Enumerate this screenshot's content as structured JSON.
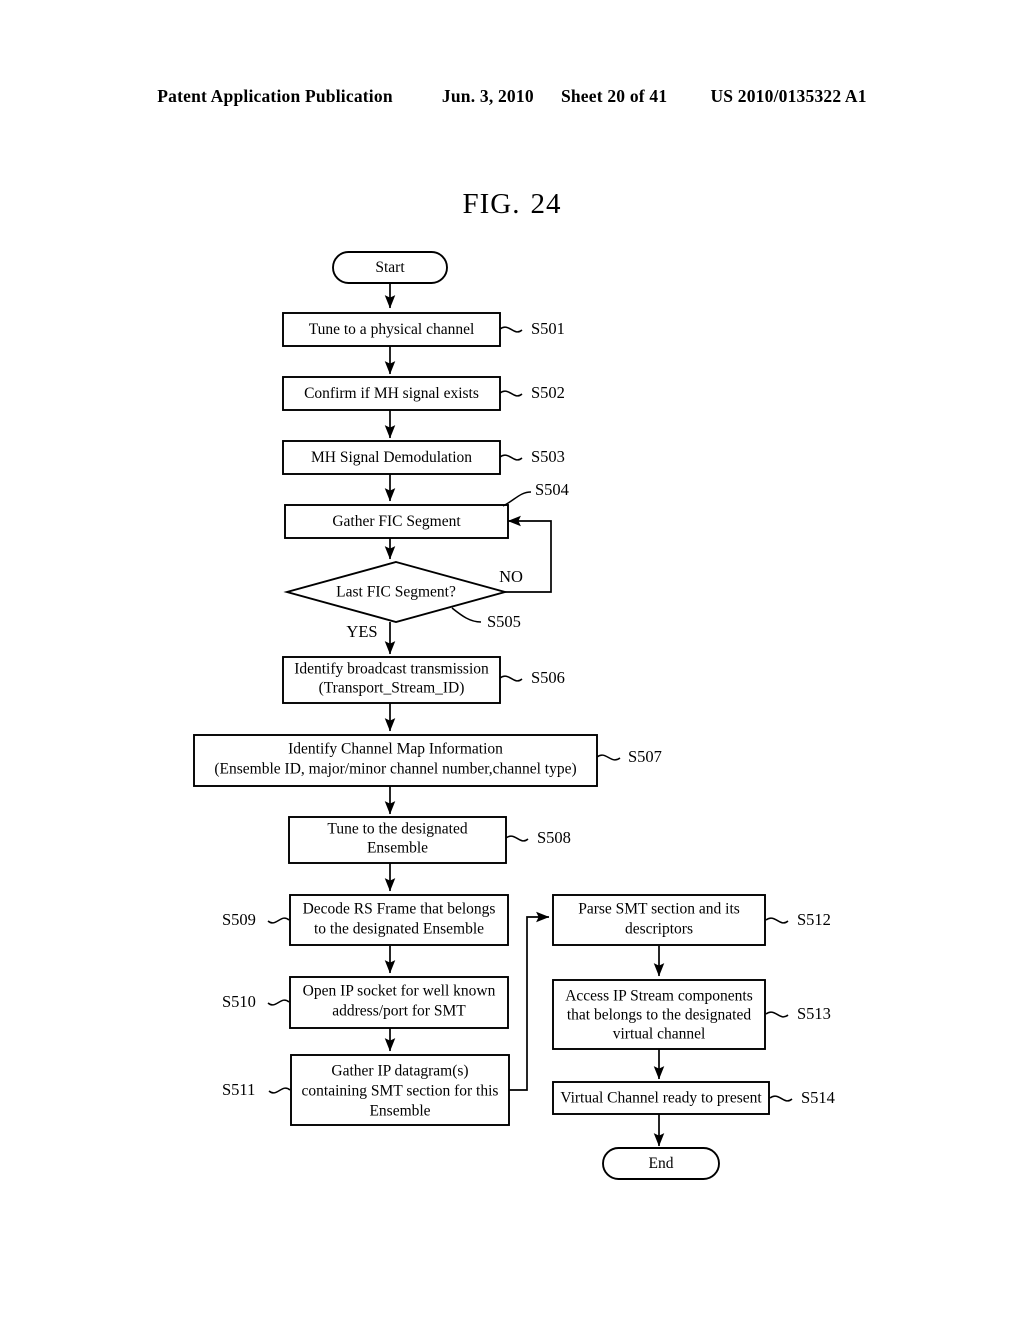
{
  "header": {
    "publication": "Patent Application Publication",
    "date": "Jun. 3, 2010",
    "sheet": "Sheet 20 of 41",
    "patent_number": "US 2010/0135322 A1"
  },
  "figure": {
    "label": "FIG.",
    "number": "24"
  },
  "flowchart": {
    "start_label": "Start",
    "end_label": "End",
    "branch_yes": "YES",
    "branch_no": "NO",
    "steps": [
      {
        "ref": "S501",
        "text": [
          "Tune to a physical channel"
        ]
      },
      {
        "ref": "S502",
        "text": [
          "Confirm if MH signal exists"
        ]
      },
      {
        "ref": "S503",
        "text": [
          "MH Signal Demodulation"
        ]
      },
      {
        "ref": "S504",
        "text": [
          "Gather FIC Segment"
        ]
      },
      {
        "ref": "S505",
        "text": [
          "Last FIC Segment?"
        ]
      },
      {
        "ref": "S506",
        "text": [
          "Identify broadcast transmission",
          "(Transport_Stream_ID)"
        ]
      },
      {
        "ref": "S507",
        "text": [
          "Identify Channel Map Information",
          "(Ensemble ID, major/minor channel number,channel type)"
        ]
      },
      {
        "ref": "S508",
        "text": [
          "Tune to the designated",
          "Ensemble"
        ]
      },
      {
        "ref": "S509",
        "text": [
          "Decode RS Frame that belongs",
          "to the designated Ensemble"
        ]
      },
      {
        "ref": "S510",
        "text": [
          "Open IP socket for well known",
          "address/port for SMT"
        ]
      },
      {
        "ref": "S511",
        "text": [
          "Gather IP datagram(s)",
          "containing SMT section for this",
          "Ensemble"
        ]
      },
      {
        "ref": "S512",
        "text": [
          "Parse SMT section and its",
          "descriptors"
        ]
      },
      {
        "ref": "S513",
        "text": [
          "Access IP Stream components",
          "that belongs to the designated",
          "virtual channel"
        ]
      },
      {
        "ref": "S514",
        "text": [
          "Virtual Channel ready to present"
        ]
      }
    ]
  },
  "colors": {
    "ink": "#000000",
    "paper": "#ffffff"
  }
}
